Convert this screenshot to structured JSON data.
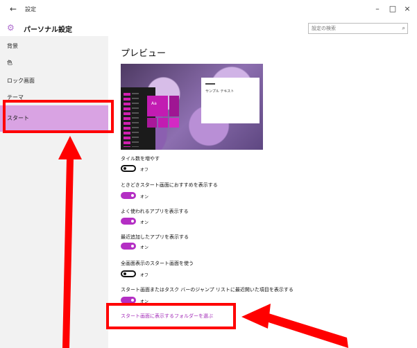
{
  "window": {
    "back_glyph": "←",
    "title": "設定",
    "minimize_glyph": "–",
    "maximize_glyph": "□",
    "close_glyph": "×"
  },
  "header": {
    "app_icon": "gear-icon",
    "app_title": "パーソナル設定",
    "search_placeholder": "設定の検索",
    "search_icon": "search-icon"
  },
  "sidebar": {
    "items": [
      {
        "label": "背景"
      },
      {
        "label": "色"
      },
      {
        "label": "ロック画面"
      },
      {
        "label": "テーマ"
      },
      {
        "label": "スタート"
      }
    ],
    "active_index": 4
  },
  "main": {
    "section_title": "プレビュー",
    "preview": {
      "tile_label": "Aa",
      "sample_text": "サンプル テキスト"
    },
    "settings": [
      {
        "label": "タイル数を増やす",
        "state": "オフ",
        "on": false
      },
      {
        "label": "ときどきスタート画面におすすめを表示する",
        "state": "オン",
        "on": true
      },
      {
        "label": "よく使われるアプリを表示する",
        "state": "オン",
        "on": true
      },
      {
        "label": "最近追加したアプリを表示する",
        "state": "オン",
        "on": true
      },
      {
        "label": "全画面表示のスタート画面を使う",
        "state": "オフ",
        "on": false
      },
      {
        "label": "スタート画面またはタスク バーのジャンプ リストに最近開いた項目を表示する",
        "state": "オン",
        "on": true
      }
    ],
    "link_label": "スタート画面に表示するフォルダーを選ぶ"
  },
  "colors": {
    "accent": "#b42fc4",
    "highlight": "#d9a3e3",
    "annotation": "#ff0000"
  }
}
